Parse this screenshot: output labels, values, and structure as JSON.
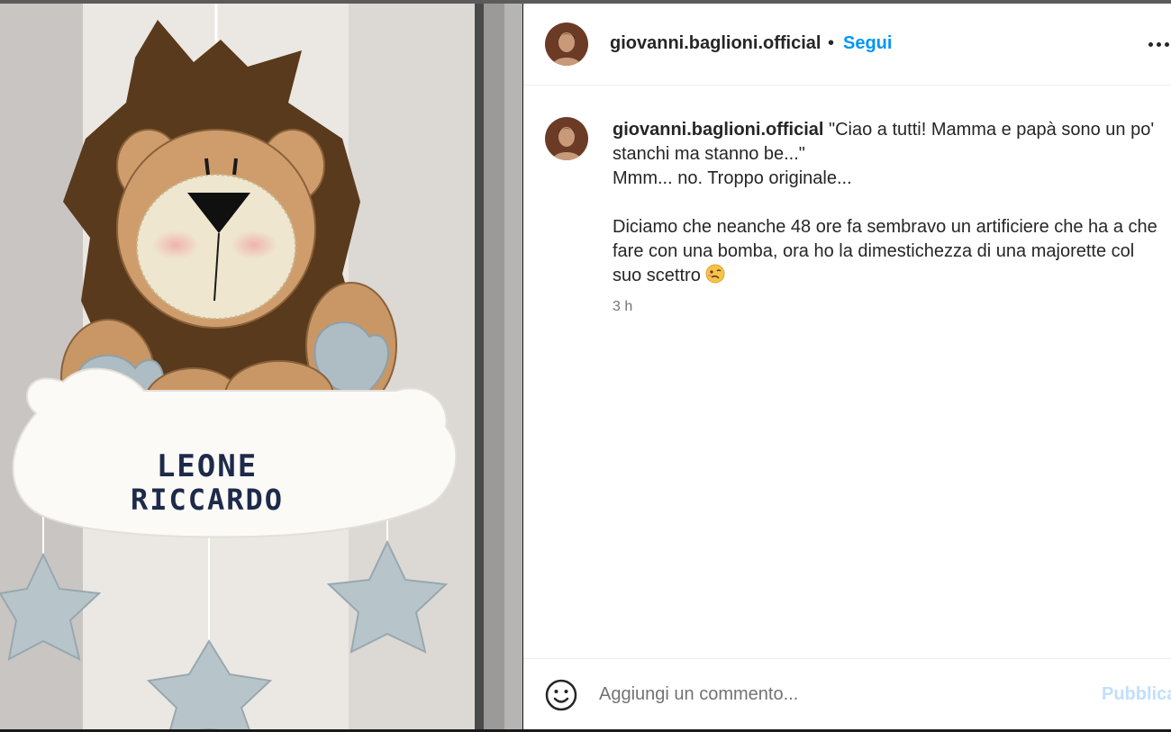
{
  "post": {
    "username": "giovanni.baglioni.official",
    "separator": "•",
    "follow_label": "Segui",
    "more_icon": "more-horizontal-icon",
    "caption_lines": [
      "\"Ciao a tutti! Mamma e papà sono un po'",
      "stanchi ma stanno be...\"",
      "Mmm... no. Troppo originale..."
    ],
    "caption_paragraph2": "Diciamo che neanche 48 ore fa sembravo un artificiere che ha a che\nfare con una bomba, ora ho la dimestichezza di una majorette col\nsuo scettro",
    "timestamp": "3 h",
    "comment_placeholder": "Aggiungi un commento...",
    "publish_label": "Pubblica",
    "emoji_icon": "smiley-icon"
  },
  "photo": {
    "decoration_text_line1": "LEONE",
    "decoration_text_line2": "RICCARDO"
  },
  "colors": {
    "link_blue": "#0095f6",
    "publish_disabled": "#c0dffd",
    "text": "#262626",
    "muted": "#737373"
  }
}
